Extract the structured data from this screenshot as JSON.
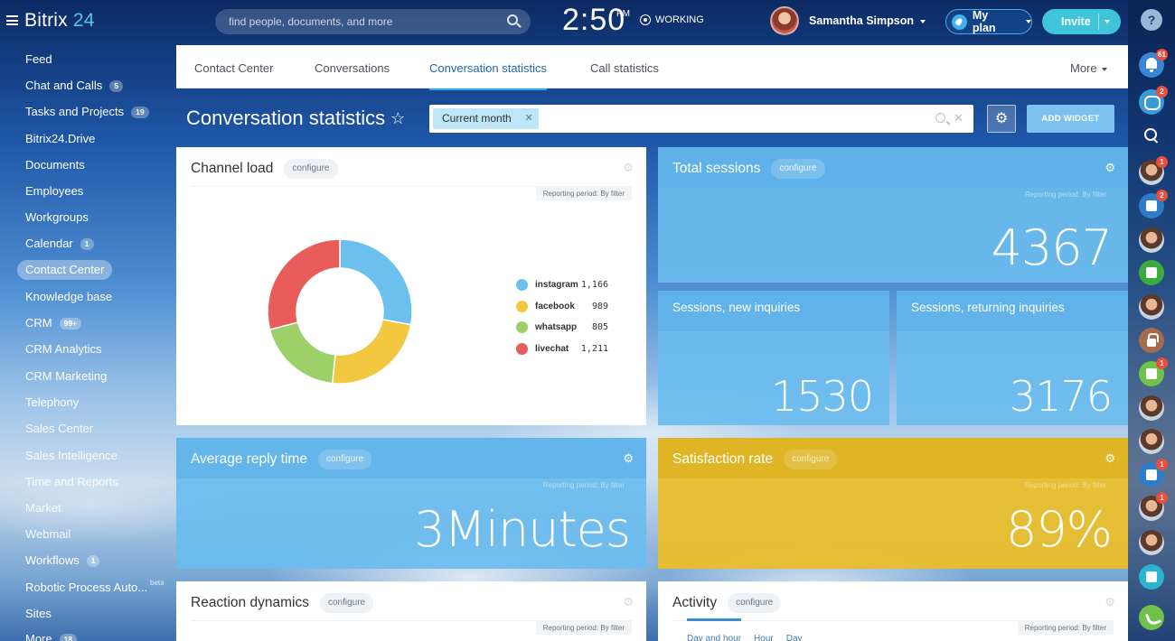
{
  "header": {
    "logo_main": "Bitrix",
    "logo_num": "24",
    "search_placeholder": "find people, documents, and more",
    "clock": "2:50",
    "ampm": "PM",
    "status": "WORKING",
    "user_name": "Samantha Simpson",
    "plan_label": "My plan",
    "invite_label": "Invite"
  },
  "sidebar": {
    "items": [
      {
        "label": "Feed",
        "count": ""
      },
      {
        "label": "Chat and Calls",
        "count": "5"
      },
      {
        "label": "Tasks and Projects",
        "count": "19"
      },
      {
        "label": "Bitrix24.Drive",
        "count": ""
      },
      {
        "label": "Documents",
        "count": ""
      },
      {
        "label": "Employees",
        "count": ""
      },
      {
        "label": "Workgroups",
        "count": ""
      },
      {
        "label": "Calendar",
        "count": "1"
      },
      {
        "label": "Contact Center",
        "count": ""
      },
      {
        "label": "Knowledge base",
        "count": ""
      },
      {
        "label": "CRM",
        "count": "99+"
      },
      {
        "label": "CRM Analytics",
        "count": ""
      },
      {
        "label": "CRM Marketing",
        "count": ""
      },
      {
        "label": "Telephony",
        "count": ""
      },
      {
        "label": "Sales Center",
        "count": ""
      },
      {
        "label": "Sales Intelligence",
        "count": ""
      },
      {
        "label": "Time and Reports",
        "count": ""
      },
      {
        "label": "Market",
        "count": ""
      },
      {
        "label": "Webmail",
        "count": ""
      },
      {
        "label": "Workflows",
        "count": "1"
      },
      {
        "label": "Robotic Process Auto...",
        "count": ""
      },
      {
        "label": "Sites",
        "count": ""
      },
      {
        "label": "More",
        "count": "18"
      }
    ],
    "beta": "beta"
  },
  "tabs": {
    "items": [
      "Contact Center",
      "Conversations",
      "Conversation statistics",
      "Call statistics"
    ],
    "more": "More"
  },
  "page": {
    "title": "Conversation statistics",
    "filter_chip": "Current month",
    "add_widget": "ADD WIDGET"
  },
  "rail": {
    "help": "?",
    "badges": {
      "notifications": "61",
      "chats": "2",
      "u1": "1",
      "g1": "2",
      "u3": "1",
      "u4": "1",
      "u5": "1",
      "u6": "1"
    }
  },
  "widgets": {
    "channel_load": {
      "title": "Channel load",
      "configure": "configure",
      "period": "Reporting period: By filter"
    },
    "total_sessions": {
      "title": "Total sessions",
      "configure": "configure",
      "period": "Reporting period: By filter",
      "value": "4367"
    },
    "new_inquiries": {
      "title": "Sessions, new inquiries",
      "value": "1530"
    },
    "returning_inquiries": {
      "title": "Sessions, returning inquiries",
      "value": "3176"
    },
    "avg_reply": {
      "title": "Average reply time",
      "configure": "configure",
      "period": "Reporting period: By filter",
      "value": "3Minutes"
    },
    "satisfaction": {
      "title": "Satisfaction rate",
      "configure": "configure",
      "period": "Reporting period: By filter",
      "value": "89%"
    },
    "reaction": {
      "title": "Reaction dynamics",
      "configure": "configure",
      "period": "Reporting period: By filter"
    },
    "activity": {
      "title": "Activity",
      "configure": "configure",
      "period": "Reporting period: By filter",
      "subtabs": [
        "Day and hour",
        "Hour",
        "Day"
      ]
    }
  },
  "chart_data": {
    "type": "pie",
    "donut": true,
    "title": "",
    "categories": [
      "instagram",
      "facebook",
      "whatsapp",
      "livechat"
    ],
    "values": [
      1166,
      989,
      805,
      1211
    ],
    "value_labels": [
      "1,166",
      "989",
      "805",
      "1,211"
    ],
    "colors": [
      "#6cc0ee",
      "#f2c83e",
      "#9ed06a",
      "#e85d5a"
    ],
    "legend": "right"
  }
}
